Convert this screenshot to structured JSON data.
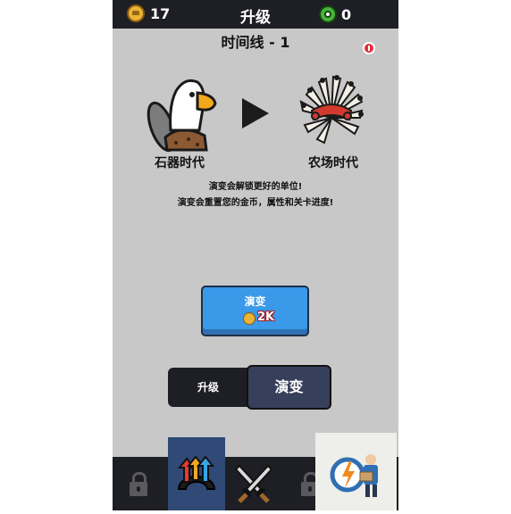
{
  "topbar": {
    "coins": "17",
    "title": "升级",
    "gems": "0",
    "coin_icon": "coin-icon",
    "gem_icon": "gem-icon"
  },
  "timeline": {
    "label": "时间线 - 1"
  },
  "evolution": {
    "from_age": "石器时代",
    "to_age": "农场时代",
    "description_line1": "演变会解锁更好的单位!",
    "description_line2": "演变会重置您的金币，属性和关卡进度!"
  },
  "evolve_button": {
    "label": "演变",
    "cost": "2K"
  },
  "mode_toggle": {
    "upgrade_label": "升级",
    "evolve_label": "演变",
    "selected": "演变"
  },
  "bottom_nav": {
    "items": [
      {
        "icon": "lock-icon",
        "state": "locked"
      },
      {
        "icon": "upgrade-arrows-icon",
        "state": "active"
      },
      {
        "icon": "crossed-swords-icon",
        "state": "normal"
      },
      {
        "icon": "lock-icon",
        "state": "locked"
      }
    ]
  },
  "colors": {
    "panel_bg": "#c8c8c8",
    "bar_bg": "#1e1f24",
    "button_blue": "#3a99e8",
    "active_tab": "#37405a",
    "nav_active": "#2f4a76"
  }
}
